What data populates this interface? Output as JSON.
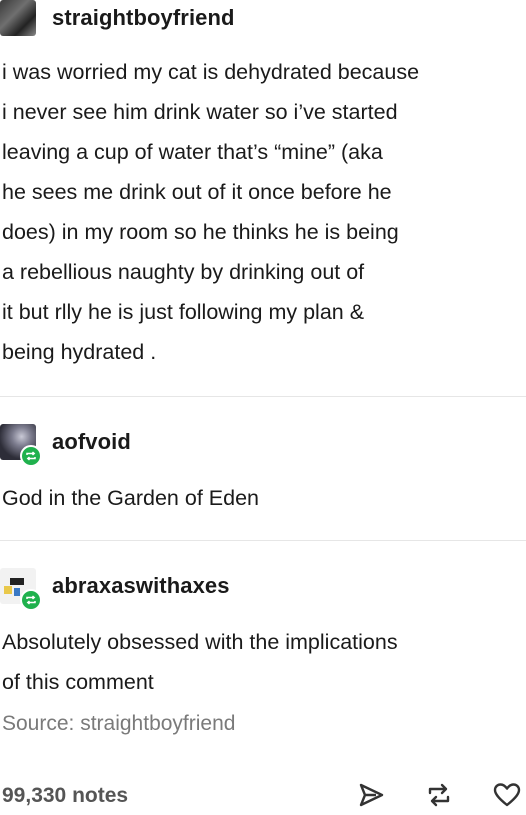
{
  "op_post": {
    "username": "straightboyfriend",
    "lines": [
      "i was worried my cat is dehydrated because",
      "i never see him drink water so i’ve started",
      "leaving a cup of water that’s “mine” (aka",
      "he sees me drink out of it once before he",
      "does) in my room so he thinks he is being",
      "a rebellious naughty by drinking out of",
      "it but rlly he is just following my plan &",
      "being hydrated ."
    ]
  },
  "reblog_1": {
    "username": "aofvoid",
    "lines": [
      "God in the Garden of Eden"
    ]
  },
  "reblog_2": {
    "username": "abraxaswithaxes",
    "lines": [
      "Absolutely obsessed with the implications",
      "of this comment"
    ]
  },
  "source": "Source: straightboyfriend",
  "footer": {
    "notes": "99,330 notes",
    "icons": [
      "share-icon",
      "reblog-icon",
      "like-icon"
    ]
  },
  "colors": {
    "reblog_badge": "#1fb14d",
    "divider": "#e6e6e6",
    "muted_text": "#7a7a7a"
  }
}
